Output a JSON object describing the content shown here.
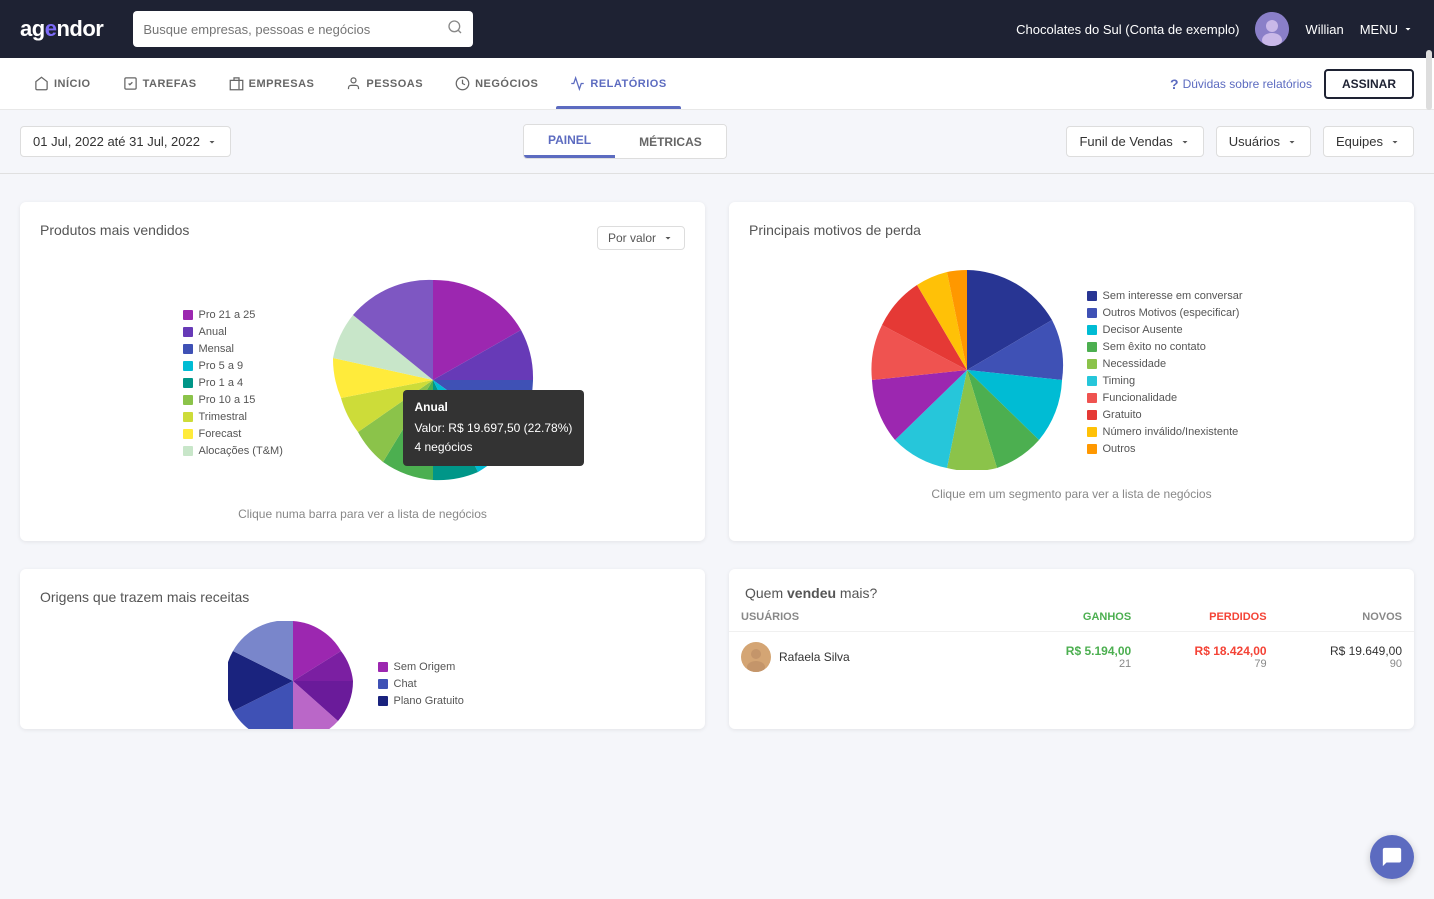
{
  "header": {
    "logo": "agendor",
    "search_placeholder": "Busque empresas, pessoas e negócios",
    "account": "Chocolates do Sul (Conta de exemplo)",
    "username": "Willian",
    "menu_label": "MENU"
  },
  "nav": {
    "items": [
      {
        "id": "inicio",
        "label": "INÍCIO",
        "icon": "home"
      },
      {
        "id": "tarefas",
        "label": "TAREFAS",
        "icon": "tasks"
      },
      {
        "id": "empresas",
        "label": "EMPRESAS",
        "icon": "building"
      },
      {
        "id": "pessoas",
        "label": "PESSOAS",
        "icon": "person"
      },
      {
        "id": "negocios",
        "label": "NEGÓCIOS",
        "icon": "dollar"
      },
      {
        "id": "relatorios",
        "label": "RELATÓRIOS",
        "icon": "chart",
        "active": true
      }
    ],
    "help_link": "Dúvidas sobre relatórios",
    "assinar_label": "ASSINAR"
  },
  "toolbar": {
    "date_range": "01 Jul, 2022 até 31 Jul, 2022",
    "tabs": [
      "PAINEL",
      "MÉTRICAS"
    ],
    "active_tab": "PAINEL",
    "filters": [
      "Funil de Vendas",
      "Usuários",
      "Equipes"
    ]
  },
  "produtos_card": {
    "title": "Produtos mais vendidos",
    "sort_label": "Por valor",
    "chart_hint": "Clique numa barra para ver a lista de negócios",
    "legend": [
      {
        "label": "Pro 21 a 25",
        "color": "#9c27b0"
      },
      {
        "label": "Anual",
        "color": "#673ab7"
      },
      {
        "label": "Mensal",
        "color": "#3f51b5"
      },
      {
        "label": "Pro 5 a 9",
        "color": "#00bcd4"
      },
      {
        "label": "Pro 1 a 4",
        "color": "#009688"
      },
      {
        "label": "Pro 10 a 15",
        "color": "#8bc34a"
      },
      {
        "label": "Trimestral",
        "color": "#cddc39"
      },
      {
        "label": "Forecast",
        "color": "#ffeb3b"
      },
      {
        "label": "Alocações (T&M)",
        "color": "#c8e6c9"
      }
    ],
    "tooltip": {
      "title": "Anual",
      "value": "Valor: R$ 19.697,50 (22.78%)",
      "count": "4 negócios"
    }
  },
  "motivos_card": {
    "title": "Principais motivos de perda",
    "chart_hint": "Clique em um segmento para ver a lista de negócios",
    "legend": [
      {
        "label": "Sem interesse em conversar",
        "color": "#283593"
      },
      {
        "label": "Outros Motivos (especificar)",
        "color": "#3f51b5"
      },
      {
        "label": "Decisor Ausente",
        "color": "#00bcd4"
      },
      {
        "label": "Sem êxito no contato",
        "color": "#4caf50"
      },
      {
        "label": "Necessidade",
        "color": "#8bc34a"
      },
      {
        "label": "Timing",
        "color": "#26c6da"
      },
      {
        "label": "Funcionalidade",
        "color": "#ef5350"
      },
      {
        "label": "Gratuito",
        "color": "#e53935"
      },
      {
        "label": "Número inválido/Inexistente",
        "color": "#ffc107"
      },
      {
        "label": "Outros",
        "color": "#ff9800"
      }
    ]
  },
  "origens_card": {
    "title": "Origens que trazem mais receitas",
    "legend": [
      {
        "label": "Sem Origem",
        "color": "#9c27b0"
      },
      {
        "label": "Chat",
        "color": "#3f51b5"
      },
      {
        "label": "Plano Gratuito",
        "color": "#1a237e"
      }
    ]
  },
  "vendeu_card": {
    "title": "Quem vendeu mais?",
    "columns": [
      "USUÁRIOS",
      "GANHOS",
      "PERDIDOS",
      "NOVOS"
    ],
    "rows": [
      {
        "name": "Rafaela Silva",
        "ganhos_val": "R$ 5.194,00",
        "ganhos_count": "21",
        "perdidos_val": "R$ 18.424,00",
        "perdidos_count": "79",
        "novos_val": "R$ 19.649,00",
        "novos_count": "90"
      }
    ]
  }
}
